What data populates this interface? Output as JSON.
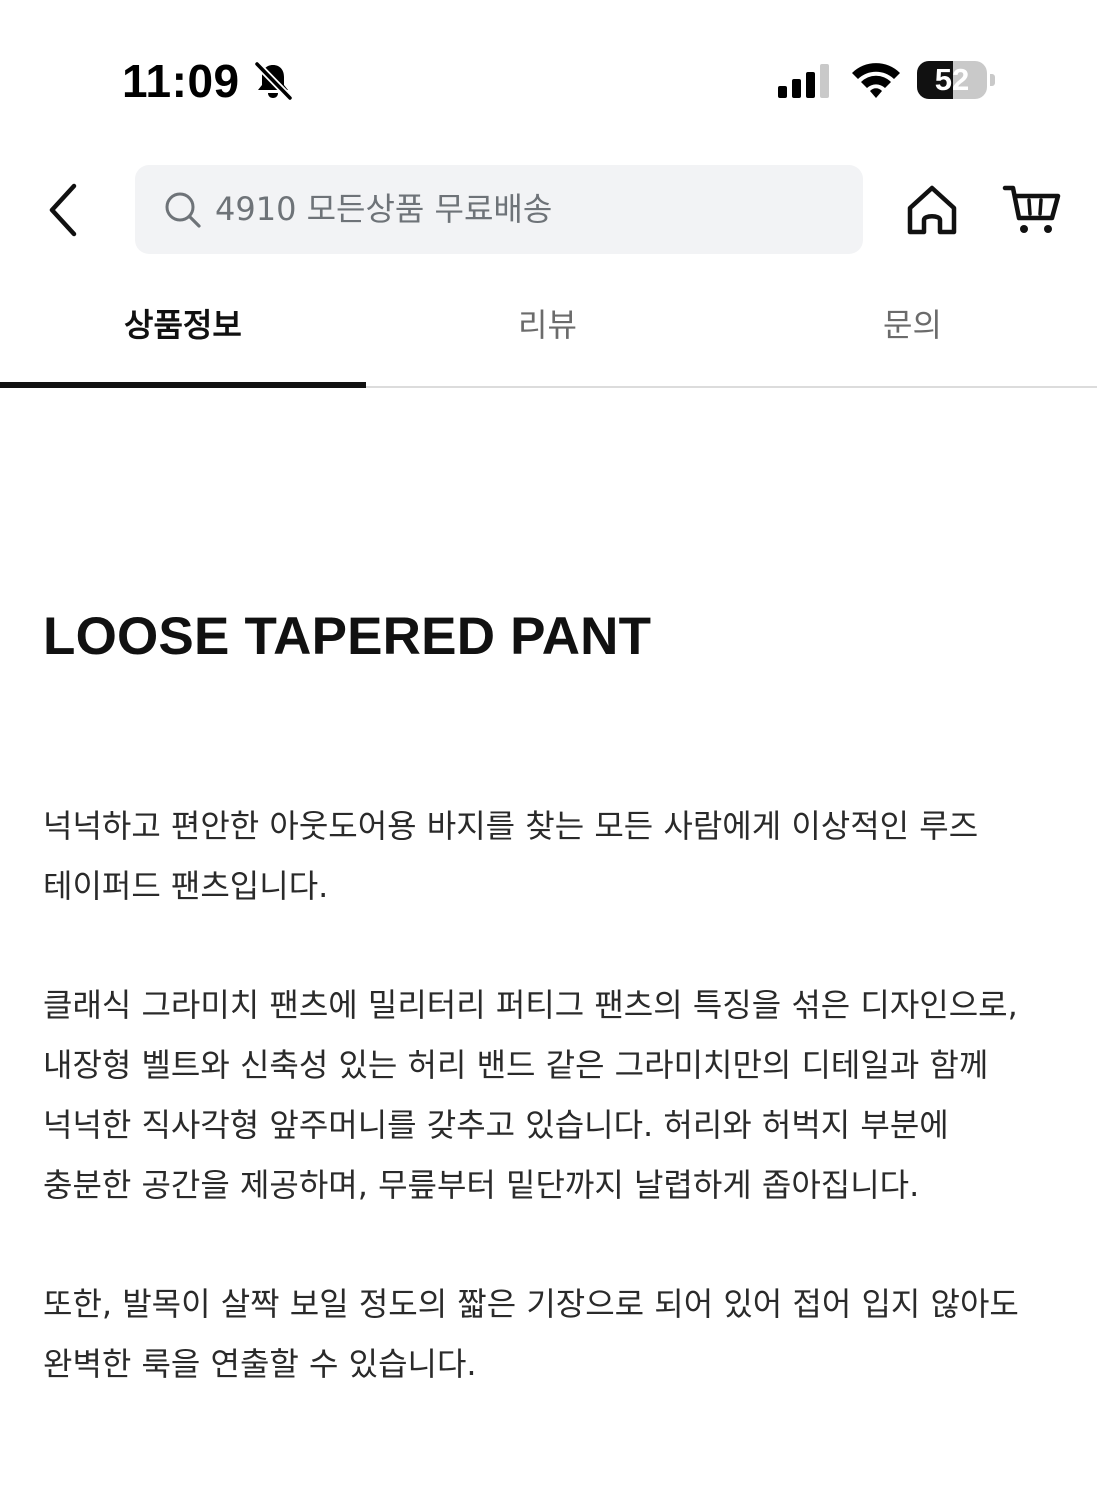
{
  "status_bar": {
    "time": "11:09",
    "battery_level": "52",
    "battery_fraction": 0.52,
    "icons": [
      "bell-slash-icon",
      "cellular-signal-icon",
      "wifi-icon",
      "battery-icon"
    ]
  },
  "header": {
    "back_icon": "chevron-left-icon",
    "search_placeholder": "4910 모든상품 무료배송",
    "home_icon": "home-icon",
    "cart_icon": "cart-icon"
  },
  "tabs": [
    {
      "label": "상품정보",
      "active": true
    },
    {
      "label": "리뷰",
      "active": false
    },
    {
      "label": "문의",
      "active": false
    }
  ],
  "content": {
    "title": "LOOSE TAPERED PANT",
    "paragraphs": [
      {
        "lines": [
          "넉넉하고 편안한 아웃도어용 바지를 찾는 모든 사람에게 이상적인 루즈",
          "테이퍼드 팬츠입니다."
        ]
      },
      {
        "lines": [
          "클래식 그라미치 팬츠에 밀리터리 퍼티그 팬츠의 특징을 섞은 디자인으로,",
          "내장형 벨트와 신축성 있는 허리 밴드 같은 그라미치만의 디테일과 함께",
          "넉넉한 직사각형 앞주머니를 갖추고 있습니다. 허리와 허벅지 부분에",
          "충분한 공간을 제공하며, 무릎부터 밑단까지 날렵하게 좁아집니다."
        ]
      },
      {
        "lines": [
          "또한, 발목이 살짝 보일 정도의 짧은 기장으로 되어 있어 접어 입지 않아도",
          "완벽한 룩을 연출할 수 있습니다."
        ]
      }
    ]
  },
  "colors": {
    "text_primary": "#111111",
    "text_body": "#2a2a2a",
    "text_muted": "#6b6b6b",
    "search_bg": "#f2f3f5",
    "tab_indicator": "#111111",
    "divider": "#dcdcdc"
  }
}
